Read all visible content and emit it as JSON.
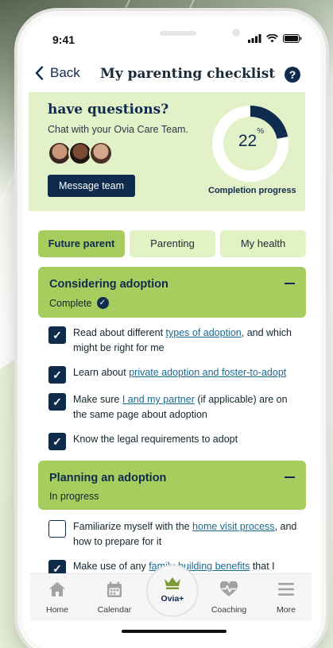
{
  "status_bar": {
    "time": "9:41"
  },
  "header": {
    "back_label": "Back",
    "title": "My parenting checklist"
  },
  "care_banner": {
    "heading": "have questions?",
    "subtext": "Chat with your Ovia Care Team.",
    "button_label": "Message team",
    "progress_value": "22",
    "progress_unit": "%",
    "progress_fraction": 0.22,
    "progress_label": "Completion progress"
  },
  "tabs": [
    {
      "label": "Future parent",
      "active": true
    },
    {
      "label": "Parenting",
      "active": false
    },
    {
      "label": "My health",
      "active": false
    }
  ],
  "sections": [
    {
      "title": "Considering adoption",
      "status": "Complete",
      "items": [
        {
          "checked": true,
          "before": "Read about different ",
          "link": "types of adoption",
          "after": ", and which might be right for me"
        },
        {
          "checked": true,
          "before": "Learn about ",
          "link": "private adoption and foster-to-adopt",
          "after": ""
        },
        {
          "checked": true,
          "before": "Make sure ",
          "link": "I and my partner",
          "after": " (if applicable) are on the same page about adoption"
        },
        {
          "checked": true,
          "before": "Know the legal requirements to adopt",
          "link": "",
          "after": ""
        }
      ]
    },
    {
      "title": "Planning an adoption",
      "status": "In progress",
      "items": [
        {
          "checked": false,
          "before": "Familiarize myself with the ",
          "link": "home visit process",
          "after": ", and how to prepare for it"
        },
        {
          "checked": true,
          "before": "Make use of any ",
          "link": "family-building benefits",
          "after": " that I"
        }
      ]
    }
  ],
  "nav": [
    {
      "label": "Home",
      "icon": "home-icon"
    },
    {
      "label": "Calendar",
      "icon": "calendar-icon"
    },
    {
      "label": "Ovia+",
      "icon": "crown-icon",
      "active": true
    },
    {
      "label": "Coaching",
      "icon": "heart-pulse-icon"
    },
    {
      "label": "More",
      "icon": "menu-icon"
    }
  ],
  "colors": {
    "navy": "#0f2b4e",
    "green": "#a6cd5e",
    "light_green": "#e3f1c9",
    "link": "#1a6a8f"
  }
}
